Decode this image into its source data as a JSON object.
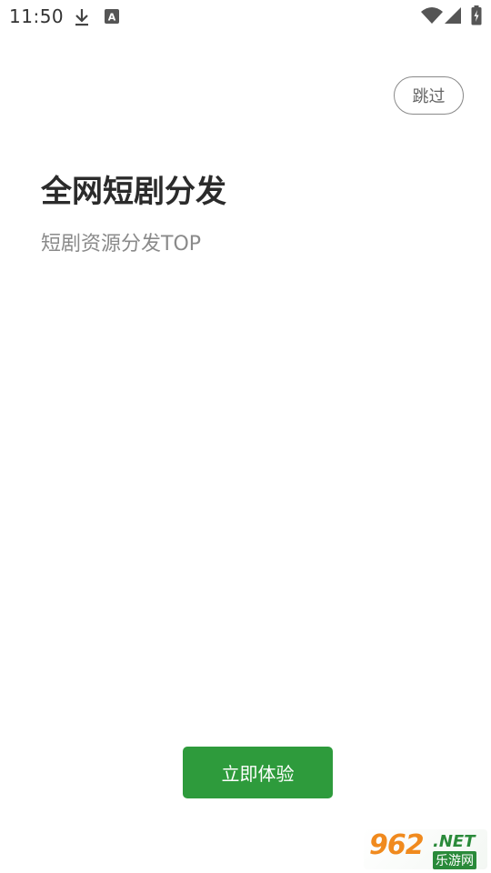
{
  "status_bar": {
    "time": "11:50",
    "icons": [
      "download-icon",
      "a-notification-icon",
      "wifi-icon",
      "signal-icon",
      "battery-icon"
    ]
  },
  "skip": {
    "label": "跳过"
  },
  "hero": {
    "title": "全网短剧分发",
    "subtitle": "短剧资源分发TOP"
  },
  "cta": {
    "label": "立即体验",
    "color": "#2e9b3c"
  },
  "watermark": {
    "brand_number": "962",
    "brand_net": ".NET",
    "brand_cn": "乐游网"
  }
}
